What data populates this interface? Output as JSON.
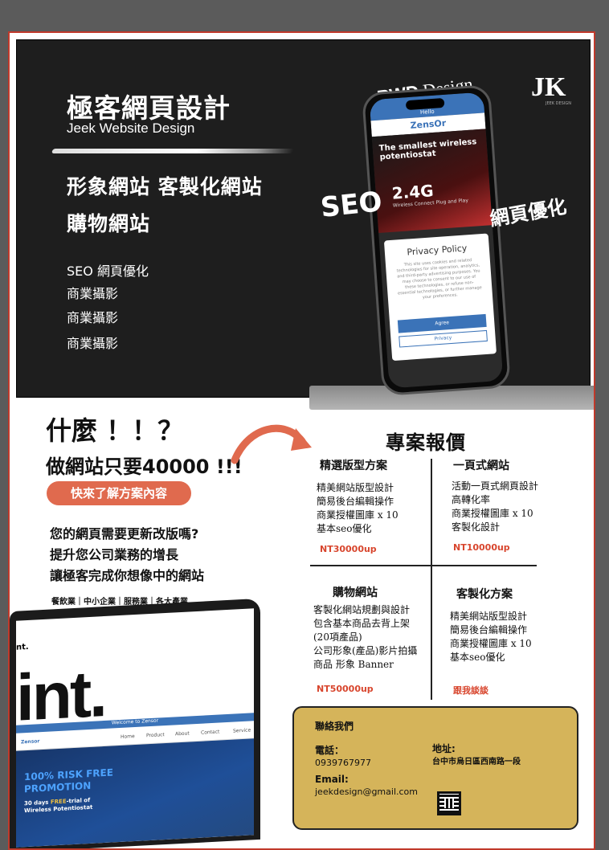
{
  "hero": {
    "title": "極客網頁設計",
    "subtitle": "Jeek Website Design",
    "services_line1": "形象網站  客製化網站",
    "services_line2": "購物網站",
    "features": [
      "SEO 網頁優化",
      "商業攝影",
      "商業攝影",
      "商業攝影"
    ],
    "rwd_bold": "RWD",
    "rwd_rest": " Design",
    "seo": "SEO",
    "optimization": "網頁優化",
    "logo_mark": "JK",
    "logo_text": "JEEK DESIGN"
  },
  "phone": {
    "hello": "Hello",
    "brand": "ZensOr",
    "headline": "The smallest wireless potentiostat",
    "big": "2.4G",
    "tag": "Wireless Connect Plug and Play",
    "privacy_title": "Privacy Policy",
    "privacy_text": "This site uses cookies and related technologies for site operation, analytics, and third-party advertising purposes. You may choose to consent to our use of these technologies, or refuse non-essential technologies, or further manage your preferences.",
    "agree": "Agree",
    "privacy_btn": "Privacy"
  },
  "pitch": {
    "q1": "什麼 ！！？",
    "q2": "做網站只要40000 !!!",
    "cta": "快來了解方案內容",
    "lines": [
      "您的網頁需要更新改版嗎?",
      "提升您公司業務的增長",
      "讓極客完成你想像中的網站"
    ],
    "industries": "餐飲業｜中小企業｜服務業｜各大產業"
  },
  "laptop": {
    "big": "int.",
    "small": "nt.",
    "welcome": "Welcome to Zensor",
    "brand": "Zensor",
    "nav": [
      "Home",
      "Product",
      "About",
      "Contact",
      "Service"
    ],
    "promo1": "100% RISK FREE",
    "promo2": "PROMOTION",
    "trial_a": "30 days ",
    "trial_b": "FREE",
    "trial_c": "-trial of",
    "trial_d": "Wireless Potentiostat"
  },
  "quote": {
    "title": "專案報價",
    "plans": [
      {
        "name": "精選版型方案",
        "items": [
          "精美網站版型設計",
          "簡易後台編輯操作",
          "商業授權圖庫 x 10",
          "基本seo優化"
        ],
        "price": "NT30000up"
      },
      {
        "name": "一頁式網站",
        "items": [
          "活動一頁式網頁設計",
          "高轉化率",
          "商業授權圖庫 x 10",
          "客製化設計"
        ],
        "price": "NT10000up"
      },
      {
        "name": "購物網站",
        "items": [
          "客製化網站規劃與設計",
          "包含基本商品去背上架",
          "(20項產品)",
          "公司形象(產品)影片拍攝",
          "商品 形象 Banner"
        ],
        "price": "NT50000up"
      },
      {
        "name": "客製化方案",
        "items": [
          "精美網站版型設計",
          "簡易後台編輯操作",
          "商業授權圖庫 x 10",
          "基本seo優化"
        ],
        "price": "跟我談談"
      }
    ]
  },
  "contact": {
    "heading": "聯絡我們",
    "phone_label": "電話：",
    "phone": "0939767977",
    "address_label": "地址:",
    "address": "台中市烏日區西南路一段",
    "email_label": "Email:",
    "email": "jeekdesign@gmail.com"
  },
  "colors": {
    "accent": "#e06a4e",
    "price": "#d8462e",
    "contact_bg": "#d5b45a",
    "hero_bg": "#1e1e1e"
  }
}
